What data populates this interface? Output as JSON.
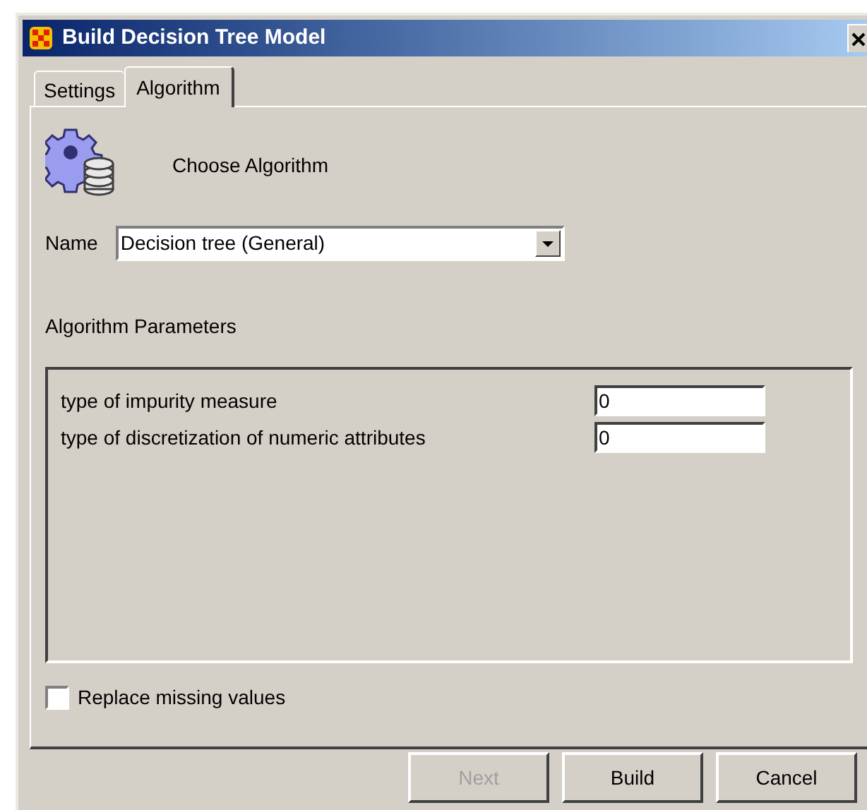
{
  "window": {
    "title": "Build Decision Tree Model"
  },
  "tabs": [
    {
      "label": "Settings",
      "selected": false
    },
    {
      "label": "Algorithm",
      "selected": true
    }
  ],
  "header": {
    "text": "Choose Algorithm"
  },
  "name_field": {
    "label": "Name",
    "value": "Decision tree (General)"
  },
  "parameters": {
    "title": "Algorithm Parameters",
    "rows": [
      {
        "label": "type of impurity measure",
        "value": "0"
      },
      {
        "label": "type of discretization of numeric attributes",
        "value": "0"
      }
    ]
  },
  "replace_missing": {
    "label": "Replace missing values",
    "checked": false
  },
  "buttons": [
    {
      "label": "Next",
      "disabled": true
    },
    {
      "label": "Build",
      "disabled": false
    },
    {
      "label": "Cancel",
      "disabled": false
    }
  ]
}
